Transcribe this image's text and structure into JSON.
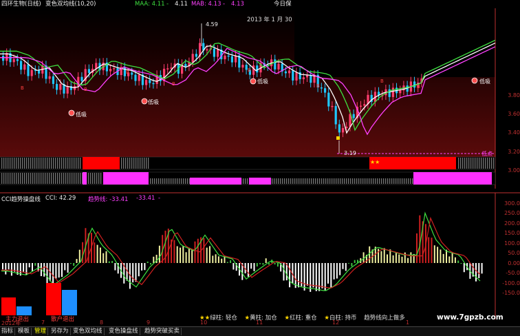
{
  "header": {
    "stock_title": "四环生物(日线)",
    "indicator_name": "变色双均线(10,20)",
    "maa_label": "MAA: 4.11",
    "maa_dash": "-",
    "maa_value2": "4.11",
    "mab_label": "MAB: 4.13",
    "mab_dash": "-",
    "mab_value2": "4.13",
    "right_text": "今日保"
  },
  "main_panel": {
    "date_text": "2013 年 1 月 30",
    "high_marker": "4.59",
    "low_marker": "3.19",
    "low_signal": "低吸",
    "low_point": "低点",
    "buy_marker": "B",
    "axis_ticks": [
      "3.80",
      "3.60",
      "3.40",
      "3.20",
      "3.00"
    ],
    "stars": "★★"
  },
  "cci_panel": {
    "name": "CCI趋势操盘线",
    "cci_value": "CCI: 42.29",
    "trend_label": "趋势线: -33.41",
    "trend_value2": "-33.41",
    "trend_dash": "-",
    "axis_ticks": [
      "300.0",
      "250.0",
      "200.0",
      "150.0",
      "100.0",
      "50.0",
      "0.00",
      "-50.0",
      "-100.0",
      "-150.0"
    ],
    "main_exit": "主力退出",
    "retail_exit": "散户退出",
    "legend": [
      {
        "star": "★★",
        "text": "绿柱: 轻仓"
      },
      {
        "star": "★",
        "text": "黄柱: 加仓"
      },
      {
        "star": "★",
        "text": "红柱: 重仓"
      },
      {
        "star": "★",
        "text": "白柱: 持币"
      },
      {
        "star": "",
        "text": "趋势线向上做多"
      }
    ],
    "watermark": "www.7gpzb.com"
  },
  "date_axis": {
    "labels": [
      "2012年",
      "7",
      "8",
      "9",
      "10",
      "11",
      "12",
      "1"
    ]
  },
  "bottom_tabs": [
    {
      "label": "指标"
    },
    {
      "label": "模板"
    },
    {
      "label": "管理"
    },
    {
      "label": "另存为"
    },
    {
      "label": "变色双均线"
    },
    {
      "label": "变色操盘线"
    },
    {
      "label": "趋势突破买卖"
    }
  ],
  "colors": {
    "bull": "#ff3d6e",
    "bear": "#1ec8ff",
    "ma_green": "#3ee040",
    "ma_white": "#ffffff",
    "ma_magenta": "#ff40ff",
    "bar_red": "#d02020",
    "bar_yellow": "#f0f0a0",
    "bar_green": "#40c040",
    "bar_white": "#ffffff",
    "axis": "#c03030"
  }
}
